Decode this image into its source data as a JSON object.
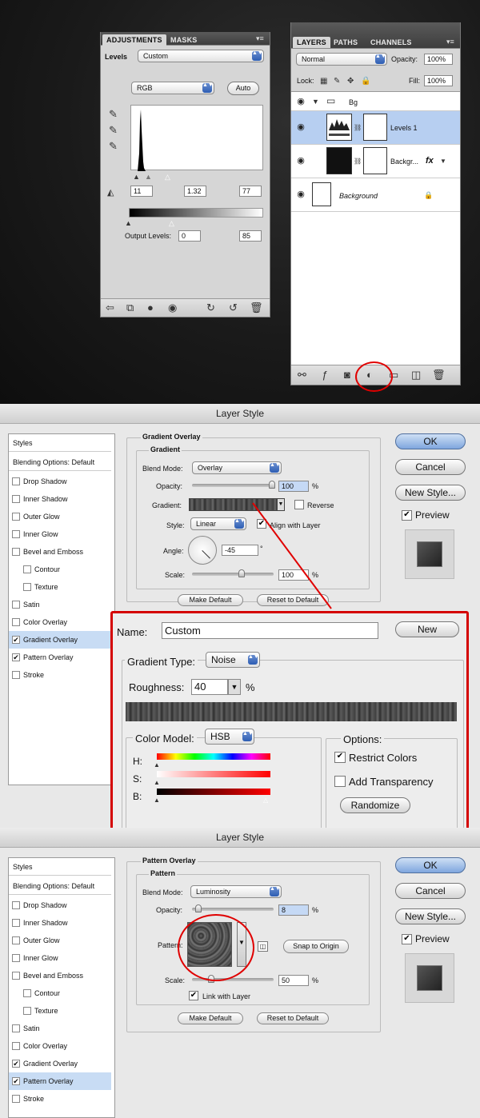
{
  "adjustments": {
    "tabs": [
      "ADJUSTMENTS",
      "MASKS"
    ],
    "title": "Levels",
    "preset": "Custom",
    "channel": "RGB",
    "auto_label": "Auto",
    "input_values": [
      "11",
      "1.32",
      "77"
    ],
    "output_label": "Output Levels:",
    "output_values": [
      "0",
      "85"
    ]
  },
  "layers": {
    "tabs": [
      "LAYERS",
      "PATHS",
      "CHANNELS"
    ],
    "blend_mode": "Normal",
    "opacity_label": "Opacity:",
    "opacity": "100%",
    "lock_label": "Lock:",
    "fill_label": "Fill:",
    "fill": "100%",
    "items": [
      {
        "name": "Bg"
      },
      {
        "name": "Levels 1"
      },
      {
        "name": "Backgr..."
      },
      {
        "name": "Background"
      }
    ],
    "fx_label": "fx"
  },
  "style1": {
    "title": "Layer Style",
    "styles_header": "Styles",
    "blending": "Blending Options: Default",
    "list": [
      {
        "label": "Drop Shadow",
        "checked": false
      },
      {
        "label": "Inner Shadow",
        "checked": false
      },
      {
        "label": "Outer Glow",
        "checked": false
      },
      {
        "label": "Inner Glow",
        "checked": false
      },
      {
        "label": "Bevel and Emboss",
        "checked": false
      },
      {
        "label": "Contour",
        "checked": false
      },
      {
        "label": "Texture",
        "checked": false
      },
      {
        "label": "Satin",
        "checked": false
      },
      {
        "label": "Color Overlay",
        "checked": false
      },
      {
        "label": "Gradient Overlay",
        "checked": true
      },
      {
        "label": "Pattern Overlay",
        "checked": true
      },
      {
        "label": "Stroke",
        "checked": false
      }
    ],
    "section": "Gradient Overlay",
    "sub": "Gradient",
    "blend_label": "Blend Mode:",
    "blend": "Overlay",
    "opacity_label": "Opacity:",
    "opacity": "100",
    "pct": "%",
    "gradient_label": "Gradient:",
    "reverse": "Reverse",
    "style_label": "Style:",
    "style": "Linear",
    "align": "Align with Layer",
    "angle_label": "Angle:",
    "angle": "-45",
    "deg": "°",
    "scale_label": "Scale:",
    "scale": "100",
    "make_default": "Make Default",
    "reset_default": "Reset to Default",
    "ok": "OK",
    "cancel": "Cancel",
    "new_style": "New Style...",
    "preview": "Preview"
  },
  "editor": {
    "name_label": "Name:",
    "name": "Custom",
    "new": "New",
    "type_label": "Gradient Type:",
    "type": "Noise",
    "rough_label": "Roughness:",
    "rough": "40",
    "pct": "%",
    "model_label": "Color Model:",
    "model": "HSB",
    "h": "H:",
    "s": "S:",
    "b": "B:",
    "options_label": "Options:",
    "restrict": "Restrict Colors",
    "transparency": "Add Transparency",
    "randomize": "Randomize"
  },
  "style2": {
    "title": "Layer Style",
    "styles_header": "Styles",
    "blending": "Blending Options: Default",
    "list": [
      {
        "label": "Drop Shadow",
        "checked": false
      },
      {
        "label": "Inner Shadow",
        "checked": false
      },
      {
        "label": "Outer Glow",
        "checked": false
      },
      {
        "label": "Inner Glow",
        "checked": false
      },
      {
        "label": "Bevel and Emboss",
        "checked": false
      },
      {
        "label": "Contour",
        "checked": false
      },
      {
        "label": "Texture",
        "checked": false
      },
      {
        "label": "Satin",
        "checked": false
      },
      {
        "label": "Color Overlay",
        "checked": false
      },
      {
        "label": "Gradient Overlay",
        "checked": true
      },
      {
        "label": "Pattern Overlay",
        "checked": true
      },
      {
        "label": "Stroke",
        "checked": false
      }
    ],
    "section": "Pattern Overlay",
    "sub": "Pattern",
    "blend_label": "Blend Mode:",
    "blend": "Luminosity",
    "opacity_label": "Opacity:",
    "opacity": "8",
    "pct": "%",
    "pattern_label": "Pattern:",
    "snap": "Snap to Origin",
    "scale_label": "Scale:",
    "scale": "50",
    "link": "Link with Layer",
    "make_default": "Make Default",
    "reset_default": "Reset to Default",
    "ok": "OK",
    "cancel": "Cancel",
    "new_style": "New Style...",
    "preview": "Preview"
  }
}
